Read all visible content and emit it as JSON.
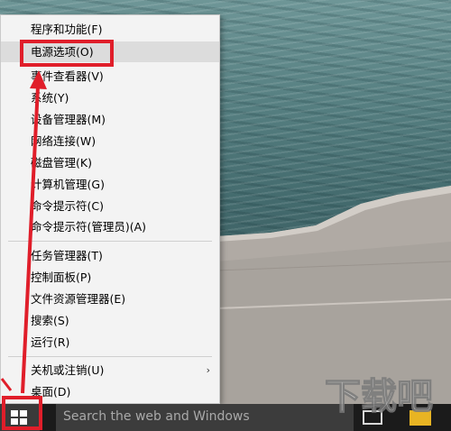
{
  "context_menu": {
    "items": [
      {
        "label": "程序和功能(F)"
      },
      {
        "label": "电源选项(O)"
      },
      {
        "label": "事件查看器(V)"
      },
      {
        "label": "系统(Y)"
      },
      {
        "label": "设备管理器(M)"
      },
      {
        "label": "网络连接(W)"
      },
      {
        "label": "磁盘管理(K)"
      },
      {
        "label": "计算机管理(G)"
      },
      {
        "label": "命令提示符(C)"
      },
      {
        "label": "命令提示符(管理员)(A)"
      },
      {
        "label": "任务管理器(T)"
      },
      {
        "label": "控制面板(P)"
      },
      {
        "label": "文件资源管理器(E)"
      },
      {
        "label": "搜索(S)"
      },
      {
        "label": "运行(R)"
      },
      {
        "label": "关机或注销(U)"
      },
      {
        "label": "桌面(D)"
      }
    ],
    "submenu_arrow": "›",
    "highlighted_item": "电源选项(O)"
  },
  "taskbar": {
    "search_placeholder": "Search the web and Windows",
    "icons": [
      "windows-logo-icon",
      "task-view-icon",
      "file-explorer-icon"
    ]
  },
  "annotation": {
    "color": "#e01e2a"
  },
  "watermark": {
    "text": "下载吧"
  }
}
